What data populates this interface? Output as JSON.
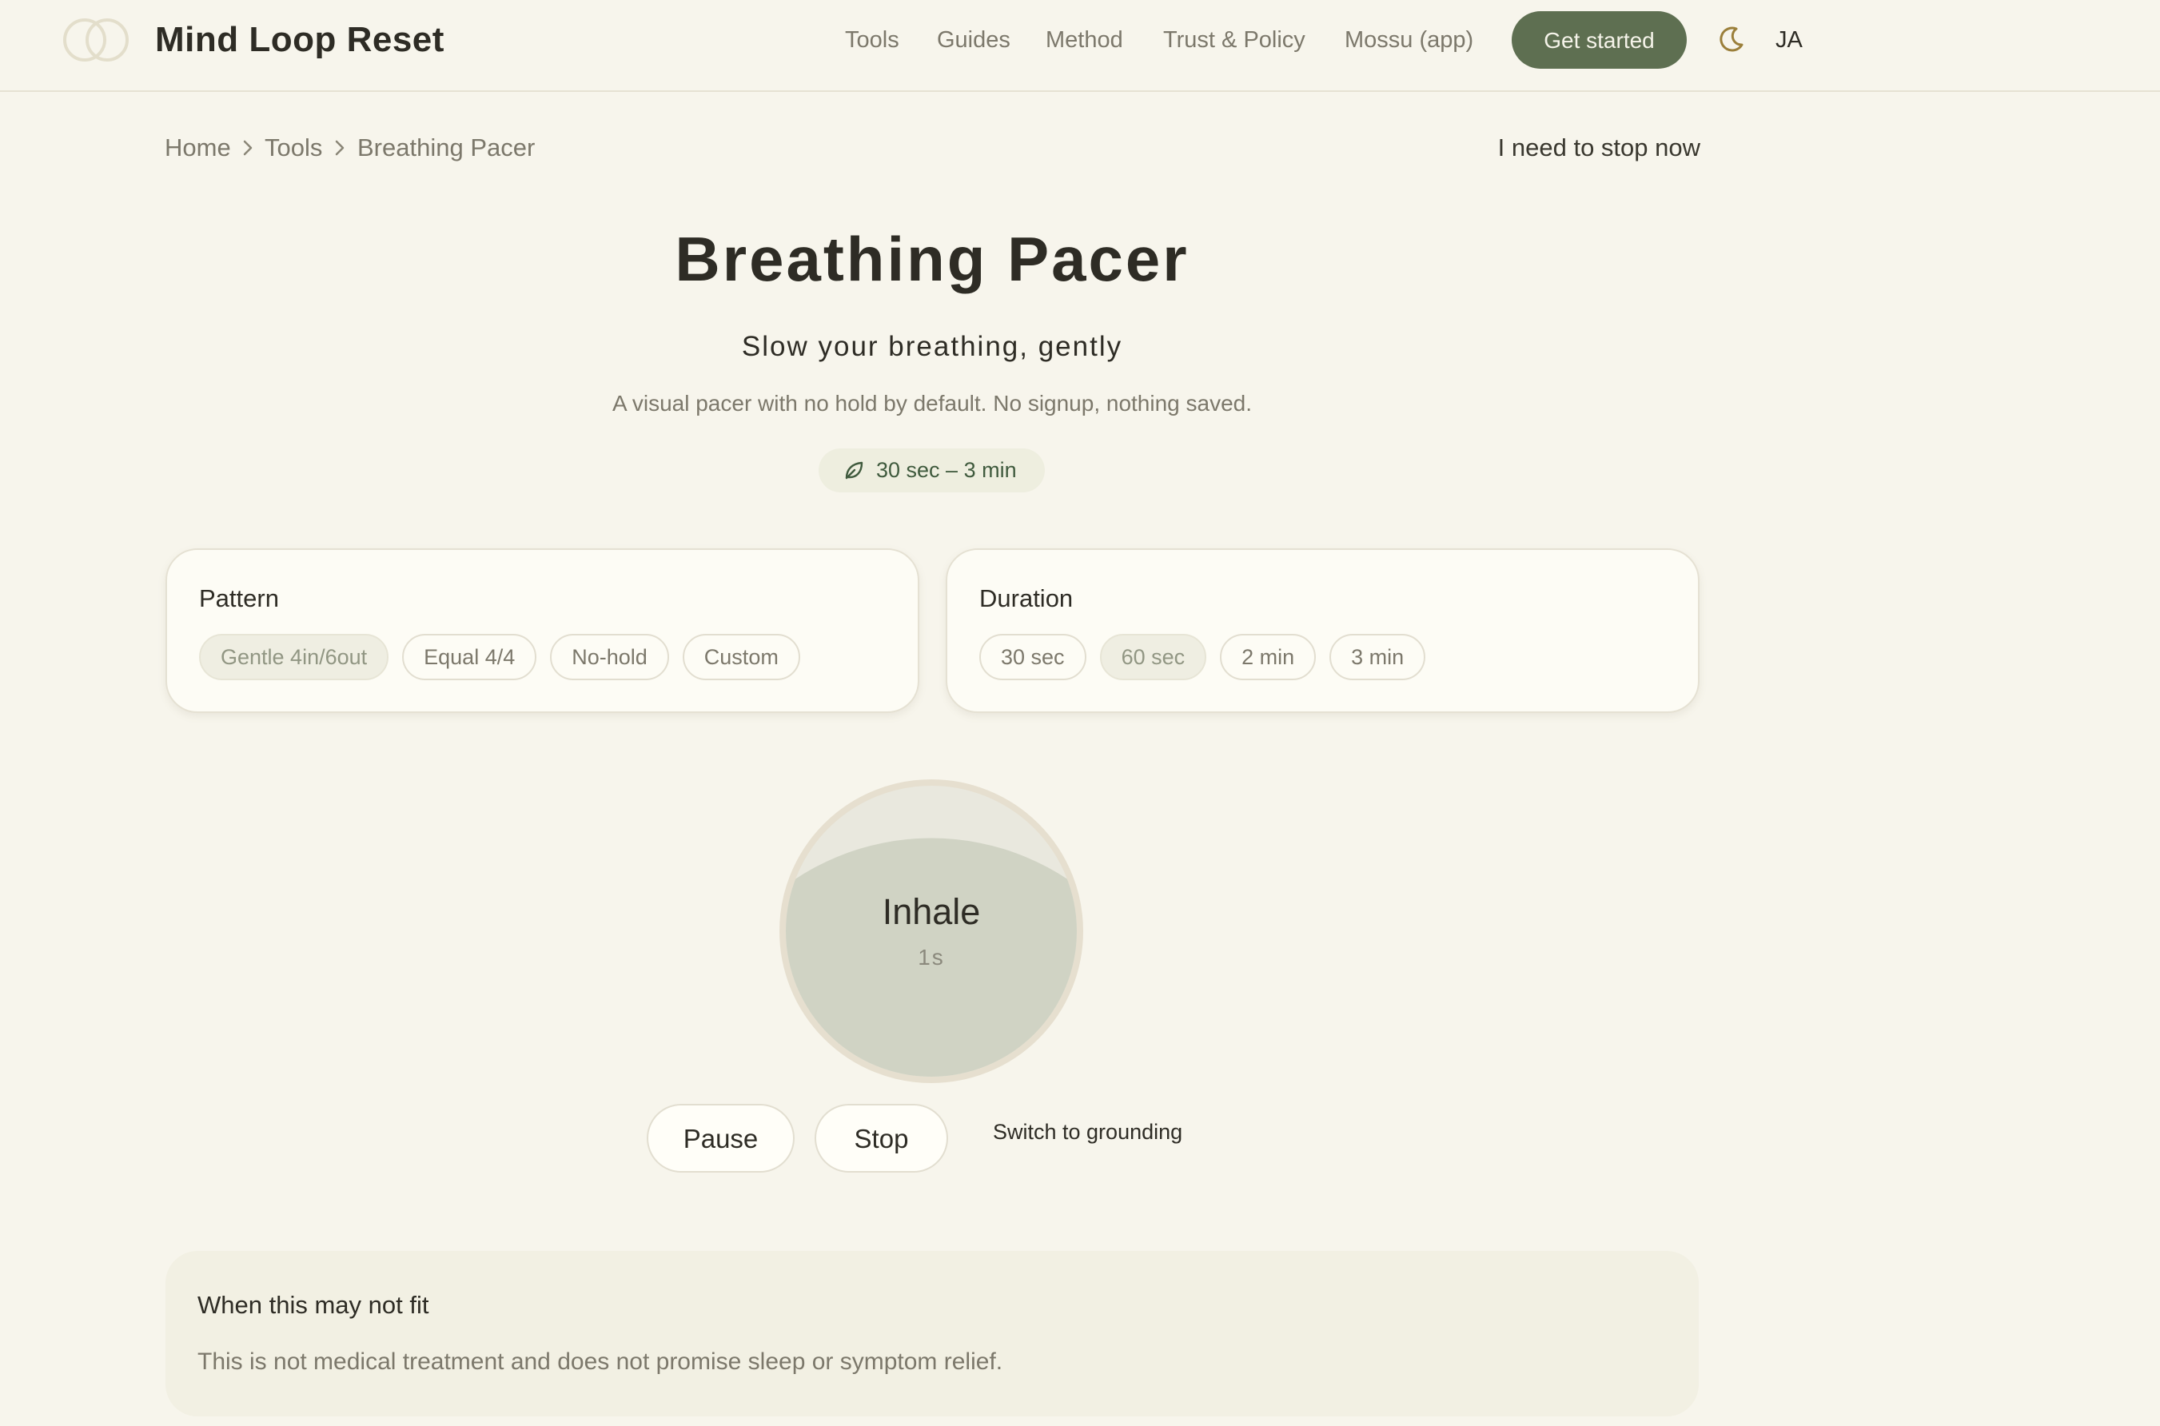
{
  "header": {
    "brand": "Mind Loop Reset",
    "nav": [
      "Tools",
      "Guides",
      "Method",
      "Trust & Policy",
      "Mossu (app)"
    ],
    "cta_label": "Get started",
    "lang_label": "JA",
    "icons": {
      "logo": "overlapping-circles-logo",
      "theme": "moon-icon"
    }
  },
  "breadcrumb": {
    "items": [
      "Home",
      "Tools",
      "Breathing Pacer"
    ],
    "separator_icon": "chevron-right-icon"
  },
  "stop_now_link": "I need to stop now",
  "hero": {
    "title": "Breathing Pacer",
    "subtitle": "Slow your breathing, gently",
    "description": "A visual pacer with no hold by default. No signup, nothing saved.",
    "badge_label": "30 sec – 3 min",
    "badge_icon": "leaf-icon"
  },
  "pattern": {
    "label": "Pattern",
    "options": [
      "Gentle 4in/6out",
      "Equal 4/4",
      "No-hold",
      "Custom"
    ],
    "selected": "Gentle 4in/6out"
  },
  "duration": {
    "label": "Duration",
    "options": [
      "30 sec",
      "60 sec",
      "2 min",
      "3 min"
    ],
    "selected": "60 sec"
  },
  "pacer": {
    "phase": "Inhale",
    "time": "1s",
    "fill_fraction": 0.82
  },
  "controls": {
    "pause_label": "Pause",
    "stop_label": "Stop",
    "switch_label": "Switch to grounding"
  },
  "note": {
    "title": "When this may not fit",
    "body": "This is not medical treatment and does not promise sleep or symptom relief."
  },
  "colors": {
    "background": "#f7f5ec",
    "accent": "#5e6f51",
    "card": "#fdfcf5",
    "pacer_fill": "#d0d3c4"
  }
}
